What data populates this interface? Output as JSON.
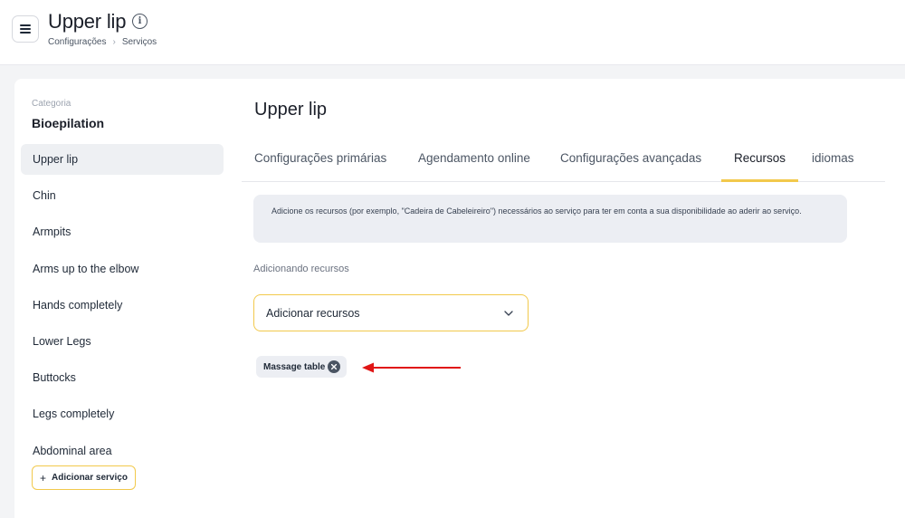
{
  "header": {
    "title": "Upper lip",
    "breadcrumb": [
      "Configurações",
      "Serviços"
    ]
  },
  "sidebar": {
    "category_label": "Categoria",
    "category_name": "Bioepilation",
    "items": [
      {
        "label": "Upper lip",
        "active": true
      },
      {
        "label": "Chin"
      },
      {
        "label": "Armpits"
      },
      {
        "label": "Arms up to the elbow"
      },
      {
        "label": "Hands completely"
      },
      {
        "label": "Lower Legs"
      },
      {
        "label": "Buttocks"
      },
      {
        "label": "Legs completely"
      },
      {
        "label": "Abdominal area"
      }
    ],
    "add_service": {
      "icon": "+",
      "label": "Adicionar serviço"
    }
  },
  "main": {
    "title": "Upper lip",
    "tabs": [
      {
        "label": "Configurações primárias"
      },
      {
        "label": "Agendamento online"
      },
      {
        "label": "Configurações avançadas"
      },
      {
        "label": "Recursos",
        "active": true
      },
      {
        "label": "idiomas"
      }
    ],
    "notice": "Adicione os recursos (por exemplo, \"Cadeira de Cabeleireiro\") necessários ao serviço para ter em conta a sua disponibilidade ao aderir ao serviço.",
    "section_label": "Adicionando recursos",
    "select_placeholder": "Adicionar recursos",
    "chips": [
      {
        "label": "Massage table"
      }
    ]
  },
  "colors": {
    "accent": "#f2c94c",
    "annotation_arrow": "#e01515"
  }
}
